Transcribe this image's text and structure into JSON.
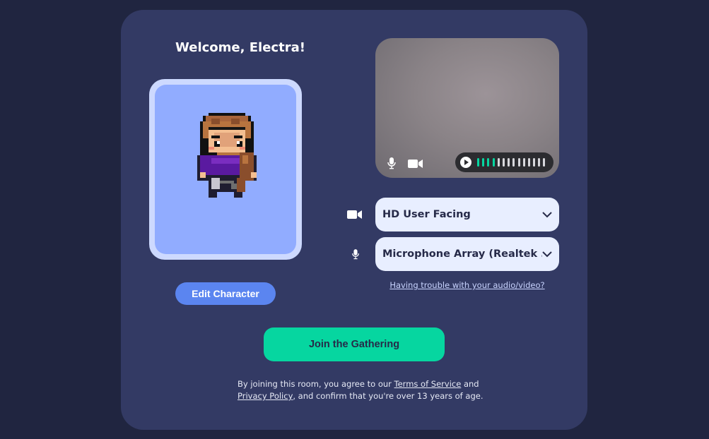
{
  "welcome": "Welcome, Electra!",
  "edit_character": "Edit Character",
  "preview": {
    "mic_icon": "microphone-icon",
    "camera_icon": "video-camera-icon",
    "meter": {
      "play_icon": "play-icon",
      "total_bars": 14,
      "active_bars": 4,
      "active_color": "#06d6a0"
    }
  },
  "devices": {
    "camera": {
      "icon": "video-camera-icon",
      "value": "HD User Facing"
    },
    "microphone": {
      "icon": "microphone-icon",
      "value": "Microphone Array (Realtek ..."
    }
  },
  "trouble_link": "Having trouble with your audio/video?",
  "join_button": "Join the Gathering",
  "terms": {
    "part1": "By joining this room, you agree to our ",
    "tos_link": "Terms of Service",
    "part2": " and",
    "privacy_link": "Privacy Policy",
    "part3": ", and confirm that you're over 13 years of age."
  },
  "colors": {
    "accent": "#06d6a0",
    "card": "#333a64",
    "background": "#202540",
    "edit_button": "#5b85f0"
  }
}
